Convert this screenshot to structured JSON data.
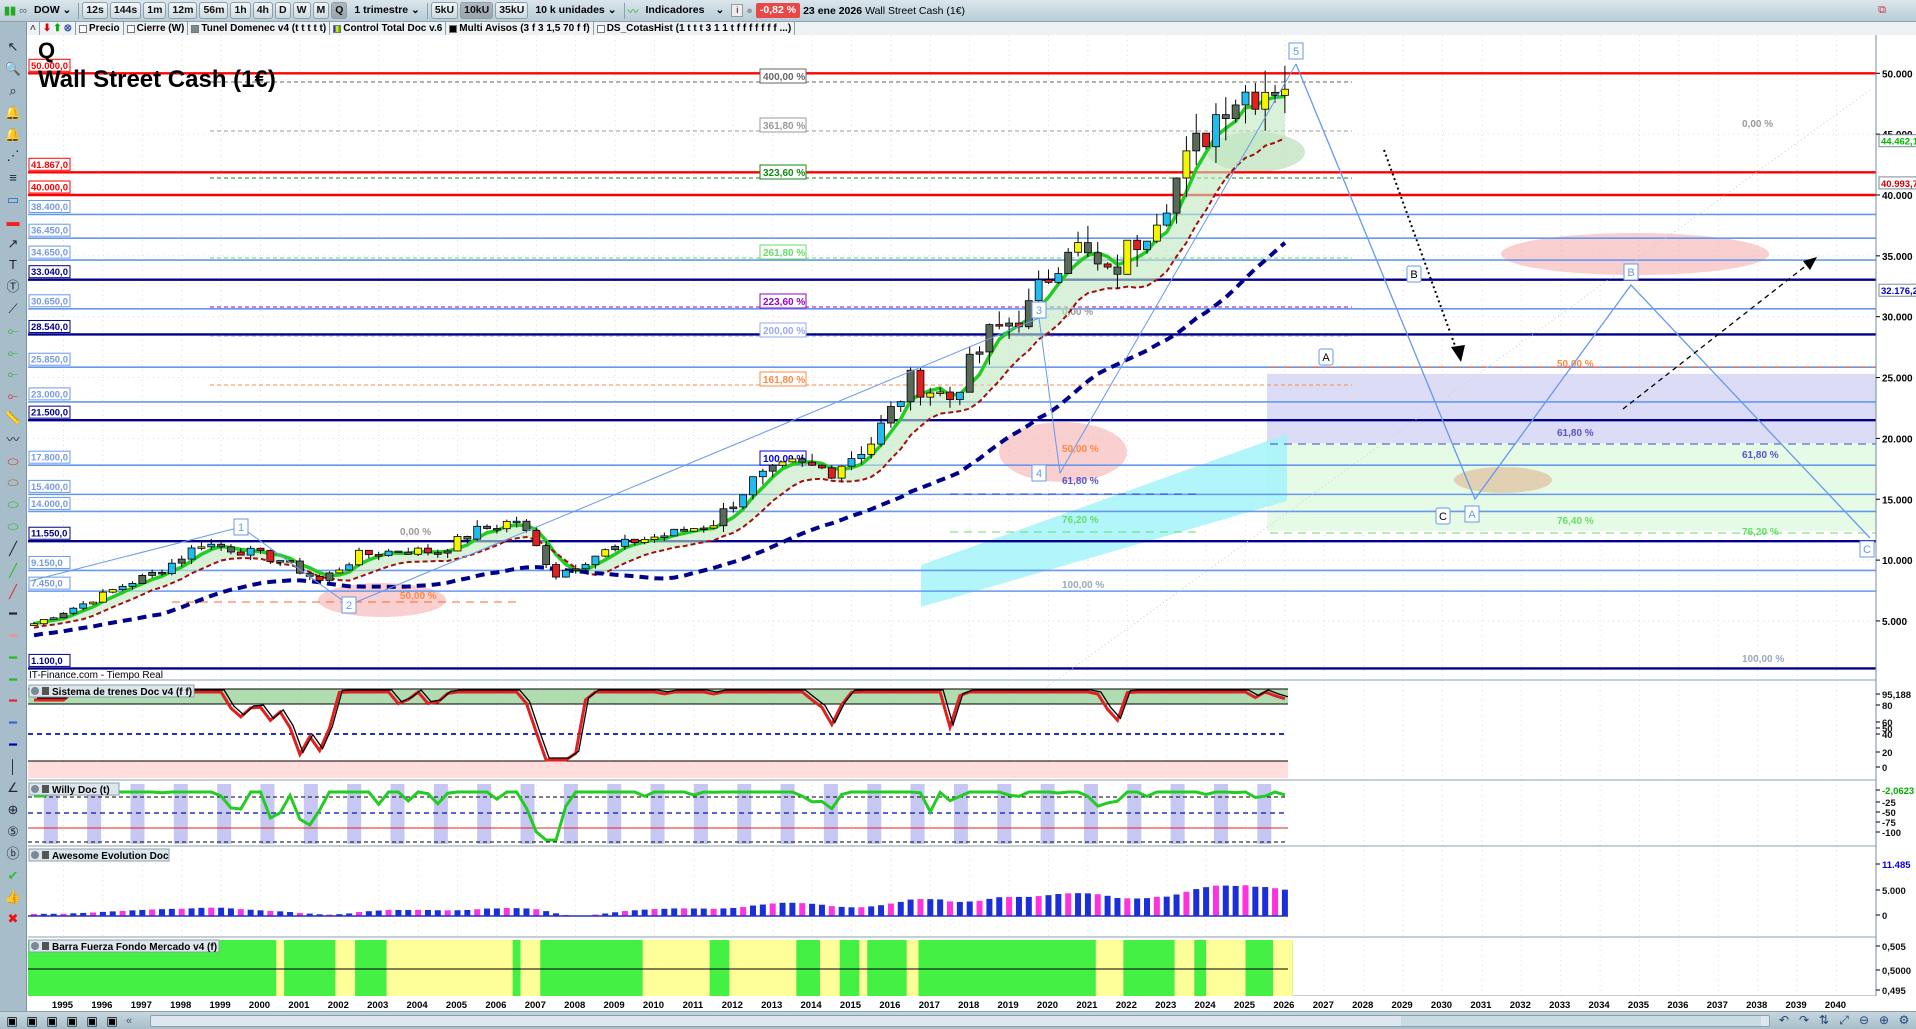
{
  "toolbar": {
    "symbol": "DOW",
    "timeframes": [
      "12s",
      "144s",
      "1m",
      "12m",
      "56m",
      "1h",
      "4h",
      "D",
      "W",
      "M",
      "Q"
    ],
    "active_timeframe": "Q",
    "period": "1 trimestre",
    "units": [
      "5kU",
      "10kU",
      "35kU"
    ],
    "active_unit": "10kU",
    "units_select": "10 k unidades",
    "indicators": "Indicadores",
    "change": "-0,82 %",
    "date": "23 ene 2026",
    "instrument": "Wall Street Cash (1€)"
  },
  "legend_bar": {
    "items": [
      "Precio",
      "Cierre (W)",
      "Tunel Domenec v4 (t t t t t)",
      "Control Total Doc v.6",
      "Multi Avisos (3 f 3 1,5 70 f f)",
      "DS_CotasHist (1 t t t 3 1 1 t f f f f f f f ...)"
    ]
  },
  "left_tools": [
    "cursor-icon",
    "zoom-icon",
    "zoom-area-icon",
    "alert-edit-icon",
    "alert-bell-icon",
    "fibonacci-fan-icon",
    "fibonacci-level-icon",
    "rectangle-blue-icon",
    "rectangle-red-icon",
    "arrow-icon",
    "text-icon",
    "text-bubble-icon",
    "segment-icon",
    "line-light-green-icon",
    "line-green-icon",
    "line-dark-green-icon",
    "line-red-icon",
    "ruler-icon",
    "pattern-icon",
    "ellipse-red-icon",
    "ellipse-brown-icon",
    "ellipse-green-icon",
    "ellipse-light-green-icon",
    "trend-line-black-icon",
    "trend-line-green-icon",
    "trend-line-red-icon",
    "hline-black-icon",
    "hline-salmon-icon",
    "hline-green-icon",
    "hline-dark-green-icon",
    "hline-red-icon",
    "hline-light-blue-icon",
    "hline-navy-icon",
    "vline-icon",
    "angle-icon",
    "circle-icon",
    "elliott-impulse-icon",
    "elliott-abc-icon",
    "check-icon",
    "thumbs-up-icon",
    "delete-icon"
  ],
  "chart": {
    "period_letter": "Q",
    "title": "Wall Street Cash (1€)",
    "source": "IT-Finance.com - Tiempo Real",
    "levels": [
      {
        "label": "50.000,0",
        "value": 50000,
        "kind": "red"
      },
      {
        "label": "41.867,0",
        "value": 41867,
        "kind": "red"
      },
      {
        "label": "40.000,0",
        "value": 40000,
        "kind": "red"
      },
      {
        "label": "38.400,0",
        "value": 38400,
        "kind": "light"
      },
      {
        "label": "36.450,0",
        "value": 36450,
        "kind": "light"
      },
      {
        "label": "34.650,0",
        "value": 34650,
        "kind": "light"
      },
      {
        "label": "33.040,0",
        "value": 33040,
        "kind": "navy"
      },
      {
        "label": "30.650,0",
        "value": 30650,
        "kind": "light"
      },
      {
        "label": "28.540,0",
        "value": 28540,
        "kind": "navy"
      },
      {
        "label": "25.850,0",
        "value": 25850,
        "kind": "light"
      },
      {
        "label": "23.000,0",
        "value": 23000,
        "kind": "light"
      },
      {
        "label": "21.500,0",
        "value": 21500,
        "kind": "navy"
      },
      {
        "label": "17.800,0",
        "value": 17800,
        "kind": "light"
      },
      {
        "label": "15.400,0",
        "value": 15400,
        "kind": "light"
      },
      {
        "label": "14.000,0",
        "value": 14000,
        "kind": "light"
      },
      {
        "label": "11.550,0",
        "value": 11550,
        "kind": "navy"
      },
      {
        "label": "9.150,0",
        "value": 9150,
        "kind": "light"
      },
      {
        "label": "7.450,0",
        "value": 7450,
        "kind": "light"
      },
      {
        "label": "1.100,0",
        "value": 1100,
        "kind": "navy"
      }
    ],
    "fib_extension": [
      {
        "label": "400,00 %",
        "color": "#666666"
      },
      {
        "label": "361,80 %",
        "color": "#999999"
      },
      {
        "label": "323,60 %",
        "color": "#118811"
      },
      {
        "label": "261,80 %",
        "color": "#66dd66"
      },
      {
        "label": "223,60 %",
        "color": "#9900cc"
      },
      {
        "label": "200,00 %",
        "color": "#99aaee"
      },
      {
        "label": "161,80 %",
        "color": "#ff8844"
      },
      {
        "label": "100,00 %",
        "color": "#0000ee"
      }
    ],
    "fib_texts": [
      {
        "label": "0,00 %",
        "color": "#999999"
      },
      {
        "label": "50,00 %",
        "color": "#ff8844"
      },
      {
        "label": "0,00 %",
        "color": "#999999"
      },
      {
        "label": "50,00 %",
        "color": "#ff8844"
      },
      {
        "label": "61,80 %",
        "color": "#5555cc"
      },
      {
        "label": "76,20 %",
        "color": "#66dd66"
      },
      {
        "label": "100,00 %",
        "color": "#99aabb"
      },
      {
        "label": "0,00 %",
        "color": "#999999"
      },
      {
        "label": "50,00 %",
        "color": "#ff8844"
      },
      {
        "label": "61,80 %",
        "color": "#5555cc"
      },
      {
        "label": "61,80 %",
        "color": "#5555cc"
      },
      {
        "label": "76,40 %",
        "color": "#66dd66"
      },
      {
        "label": "76,20 %",
        "color": "#66dd66"
      },
      {
        "label": "100,00 %",
        "color": "#99aabb"
      }
    ],
    "wave_labels": [
      "1",
      "2",
      "3",
      "4",
      "5",
      "A",
      "B",
      "C",
      "A",
      "B",
      "C"
    ],
    "price_axis": [
      "50.000",
      "45.000",
      "40.000",
      "35.000",
      "30.000",
      "25.000",
      "20.000",
      "15.000",
      "10.000",
      "5.000"
    ],
    "price_axis_values": [
      50000,
      45000,
      40000,
      35000,
      30000,
      25000,
      20000,
      15000,
      10000,
      5000
    ],
    "price_tags": [
      {
        "label": "44.462,1",
        "value": 44462.1,
        "color": "#00bb00"
      },
      {
        "label": "40.993,7",
        "value": 40993.7,
        "color": "#cc0000"
      },
      {
        "label": "32.176,2",
        "value": 32176.2,
        "color": "#0000cc"
      }
    ]
  },
  "chart_data": {
    "type": "candlestick",
    "title": "Wall Street Cash (1€)",
    "period": "quarterly",
    "years": [
      1994,
      1995,
      1996,
      1997,
      1998,
      1999,
      2000,
      2001,
      2002,
      2003,
      2004,
      2005,
      2006,
      2007,
      2008,
      2009,
      2010,
      2011,
      2012,
      2013,
      2014,
      2015,
      2016,
      2017,
      2018,
      2019,
      2020,
      2021,
      2022,
      2023,
      2024,
      2025,
      2026
    ],
    "approx_close": [
      3800,
      5100,
      6400,
      7900,
      9200,
      11400,
      10800,
      10000,
      8300,
      10400,
      10800,
      10700,
      12400,
      13300,
      8800,
      10400,
      11600,
      12200,
      13100,
      16500,
      17800,
      17400,
      19700,
      24700,
      23300,
      28500,
      30600,
      36300,
      33100,
      37600,
      42500,
      48000,
      49000
    ],
    "x_ticks": [
      "1995",
      "1996",
      "1997",
      "1998",
      "1999",
      "2000",
      "2001",
      "2002",
      "2003",
      "2004",
      "2005",
      "2006",
      "2007",
      "2008",
      "2009",
      "2010",
      "2011",
      "2012",
      "2013",
      "2014",
      "2015",
      "2016",
      "2017",
      "2018",
      "2019",
      "2020",
      "2021",
      "2022",
      "2023",
      "2024",
      "2025",
      "2026",
      "2027",
      "2028",
      "2029",
      "2030",
      "2031",
      "2032",
      "2033",
      "2034",
      "2035",
      "2036",
      "2037",
      "2038",
      "2039",
      "2040"
    ],
    "ylim": [
      0,
      52000
    ]
  },
  "panels": {
    "sistema": {
      "title": "Sistema de trenes Doc v4 (f f)",
      "axis": [
        "95,188",
        "80",
        "60",
        "50",
        "40",
        "20",
        "0"
      ]
    },
    "willy": {
      "title": "Willy Doc (t)",
      "axis": [
        "-2,0623",
        "-25",
        "-50",
        "-75",
        "-100"
      ]
    },
    "awesome": {
      "title": "Awesome Evolution Doc",
      "axis": [
        "11.485",
        "5.000",
        "0"
      ]
    },
    "barra": {
      "title": "Barra Fuerza Fondo Mercado v4 (f)",
      "axis": [
        "0,505",
        "0,5000",
        "0,495"
      ],
      "yellow_periods": [
        [
          2000.9,
          2001.1
        ],
        [
          2002.4,
          2002.9
        ],
        [
          2003.7,
          2006.9
        ],
        [
          2007.1,
          2007.6
        ],
        [
          2010.2,
          2011.9
        ],
        [
          2012.4,
          2014.1
        ],
        [
          2014.7,
          2015.2
        ],
        [
          2015.7,
          2015.9
        ],
        [
          2016.9,
          2017.2
        ],
        [
          2021.7,
          2022.4
        ],
        [
          2023.7,
          2024.2
        ],
        [
          2024.5,
          2025.5
        ],
        [
          2026.2,
          2026.7
        ]
      ]
    }
  },
  "bottom_tools": [
    "draw-icon",
    "share-icon",
    "comment-icon",
    "report-icon",
    "layers-icon",
    "chart-export-icon"
  ],
  "bottom_right_tools": [
    "undo-icon",
    "redo-icon",
    "sync-icon",
    "zoom-fit-icon",
    "zoom-out-icon",
    "zoom-in-icon",
    "settings-icon"
  ],
  "colors": {
    "up": "#f5f500",
    "down": "#e02020",
    "navy": "#00008b",
    "light_level": "#6699ee",
    "ma_green": "#22cc22"
  }
}
